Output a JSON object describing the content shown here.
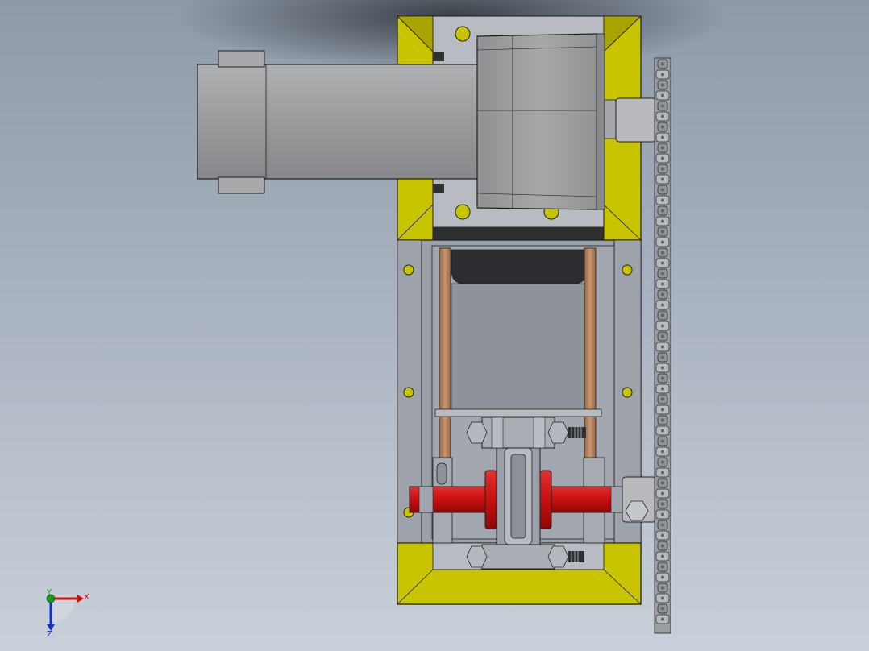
{
  "view": {
    "background_top": "#8e9aa8",
    "background_bottom": "#c9d0da",
    "shadow": "#2c3036"
  },
  "colors": {
    "frame": "#c9c400",
    "frame_dark": "#8f8b00",
    "steel": "#9ea3ab",
    "steel_light": "#b9bdc3",
    "steel_dark": "#6e737a",
    "motor": "#9b9c9e",
    "red_part": "#c80f0f",
    "rod": "#b07e54",
    "outline": "#202020",
    "chain": "#8a8a8a"
  },
  "triad": {
    "x_label": "X",
    "y_label": "Y",
    "z_label": "Z",
    "x_color": "#d01010",
    "y_color": "#10a010",
    "z_color": "#1030d0"
  }
}
